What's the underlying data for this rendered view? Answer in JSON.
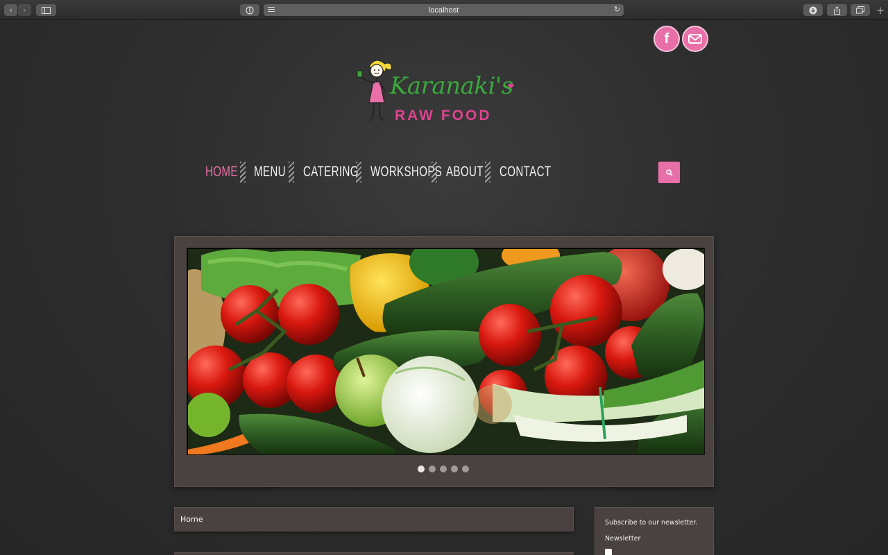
{
  "browser": {
    "url": "localhost",
    "icons": {
      "back": "chevron-left-icon",
      "forward": "chevron-right-icon",
      "sidebar": "sidebar-icon",
      "privacy": "info-icon",
      "reader": "reader-lines-icon",
      "reload": "reload-icon",
      "download": "download-icon",
      "share": "share-icon",
      "tabs": "tabs-icon",
      "new_tab": "plus-icon"
    }
  },
  "social": {
    "facebook_glyph": "f",
    "facebook_icon": "facebook-icon",
    "email_icon": "email-icon"
  },
  "logo": {
    "title": "Karanaki's",
    "subtitle": "RAW FOOD"
  },
  "nav": {
    "items": [
      {
        "label": "HOME",
        "active": true
      },
      {
        "label": "MENU",
        "active": false
      },
      {
        "label": "CATERING",
        "active": false
      },
      {
        "label": "WORKSHOPS",
        "active": false
      },
      {
        "label": "ABOUT",
        "active": false
      },
      {
        "label": "CONTACT",
        "active": false
      }
    ],
    "search_icon": "search-icon"
  },
  "slider": {
    "slide_count": 5,
    "active_index": 0,
    "image": "fresh-vegetables-photo"
  },
  "breadcrumb": {
    "label": "Home"
  },
  "newsletter": {
    "heading": "Subscribe to our newsletter.",
    "field_label": "Newsletter",
    "checked": false
  },
  "colors": {
    "accent": "#e86fa8",
    "logo_green": "#3aa83c",
    "logo_pink": "#e0438f",
    "panel": "#4a4240",
    "background": "#2e2e2e"
  }
}
